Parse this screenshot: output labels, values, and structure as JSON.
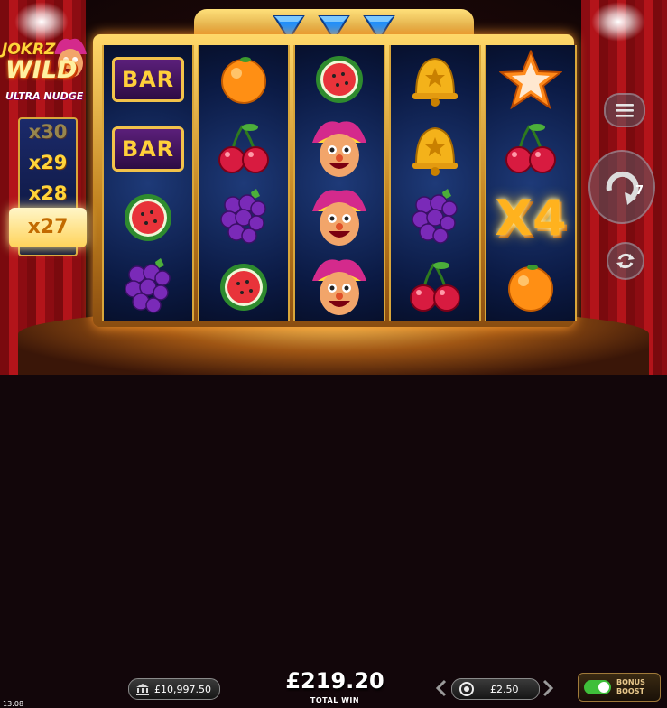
{
  "game": {
    "logo": {
      "line1": "JOKRZ",
      "line2": "WILD",
      "line3": "ULTRA NUDGE"
    },
    "multiplier_ladder": {
      "values": [
        "x30",
        "x29",
        "x28"
      ],
      "active": "x27"
    },
    "reels": [
      [
        "bar",
        "bar",
        "watermelon",
        "grapes"
      ],
      [
        "orange",
        "cherries",
        "grapes",
        "watermelon"
      ],
      [
        "watermelon",
        "jester-wild",
        "jester-wild",
        "jester-wild"
      ],
      [
        "bell",
        "bell",
        "grapes",
        "cherries"
      ],
      [
        "star",
        "cherries",
        "x4",
        "orange"
      ]
    ],
    "symbol_text": {
      "bar": "BAR",
      "x4": "X4"
    },
    "side_buttons": {
      "menu_icon": "hamburger-menu-icon",
      "spin_icon": "spin-arrow-icon",
      "autoplay_count": "7",
      "autoplay_icon": "autoplay-arrows-icon"
    }
  },
  "footer": {
    "clock": "13:08",
    "balance": "£10,997.50",
    "balance_icon": "bank-icon",
    "total_win": "£219.20",
    "total_win_label": "TOTAL WIN",
    "bet": "£2.50",
    "bet_icon": "chip-icon",
    "bonus_boost": "BONUS BOOST",
    "bonus_boost_line1": "BONUS",
    "bonus_boost_line2": "BOOST",
    "bonus_boost_on": true
  },
  "colors": {
    "frame_gold": "#d9a63a",
    "reel_blue": "#0b1a44",
    "curtain_red": "#b3141a",
    "win_text": "#ffffff",
    "x4_orange": "#ffb21e",
    "toggle_green": "#3fbf3a"
  }
}
